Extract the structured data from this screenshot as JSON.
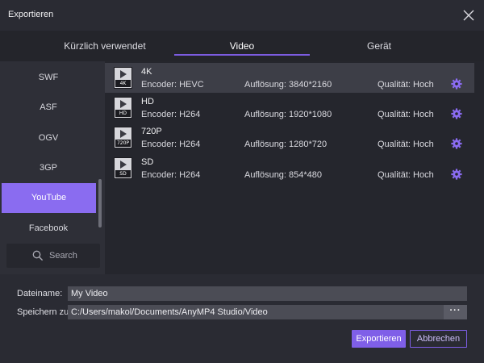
{
  "window": {
    "title": "Exportieren"
  },
  "tabs": [
    {
      "label": "Kürzlich verwendet"
    },
    {
      "label": "Video"
    },
    {
      "label": "Gerät"
    }
  ],
  "sidebar": {
    "items": [
      {
        "label": "SWF"
      },
      {
        "label": "ASF"
      },
      {
        "label": "OGV"
      },
      {
        "label": "3GP"
      },
      {
        "label": "YouTube"
      },
      {
        "label": "Facebook"
      }
    ],
    "selected": "YouTube",
    "search_placeholder": "Search"
  },
  "presets": [
    {
      "name": "4K",
      "badge": "4K",
      "encoder": "Encoder: HEVC",
      "resolution": "Auflösung: 3840*2160",
      "quality": "Qualität: Hoch"
    },
    {
      "name": "HD",
      "badge": "HD",
      "encoder": "Encoder: H264",
      "resolution": "Auflösung: 1920*1080",
      "quality": "Qualität: Hoch"
    },
    {
      "name": "720P",
      "badge": "720P",
      "encoder": "Encoder: H264",
      "resolution": "Auflösung: 1280*720",
      "quality": "Qualität: Hoch"
    },
    {
      "name": "SD",
      "badge": "SD",
      "encoder": "Encoder: H264",
      "resolution": "Auflösung: 854*480",
      "quality": "Qualität: Hoch"
    }
  ],
  "form": {
    "filename_label": "Dateiname:",
    "filename_value": "My Video",
    "save_label": "Speichern zu:",
    "save_path": "C:/Users/makol/Documents/AnyMP4 Studio/Video",
    "more_label": "···"
  },
  "buttons": {
    "export": "Exportieren",
    "cancel": "Abbrechen"
  },
  "icons": {
    "close": "close-icon",
    "search": "search-icon",
    "settings": "gear-icon",
    "thumbnail": "video-thumbnail-icon"
  },
  "colors": {
    "accent": "#7f5fe8",
    "sidebar_selected": "#8a6cf0",
    "gear": "#8b6cf2"
  }
}
